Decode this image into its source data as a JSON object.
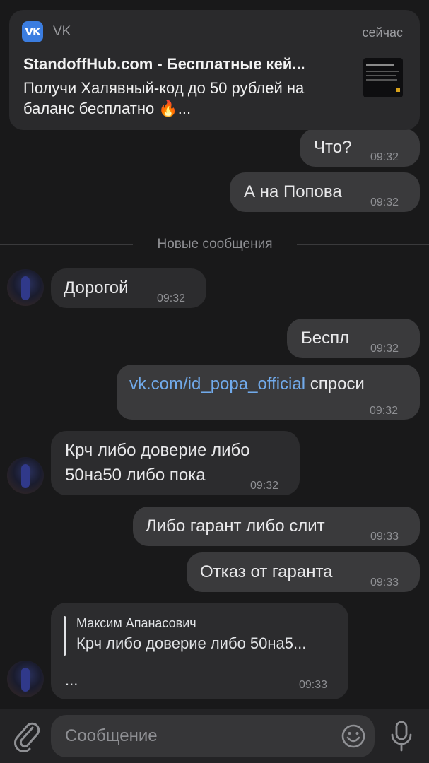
{
  "notification": {
    "app_name": "VK",
    "logo_text": "VK",
    "time": "сейчас",
    "title": "StandoffHub.com - Бесплатные кей...",
    "body": "Получи Халявный-код до 50 рублей на баланс бесплатно 🔥..."
  },
  "divider": {
    "label": "Новые сообщения"
  },
  "messages": [
    {
      "text": "Что?",
      "time": "09:32"
    },
    {
      "text": "А на Попова",
      "time": "09:32"
    },
    {
      "text": "Дорогой",
      "time": "09:32"
    },
    {
      "text": "Беспл",
      "time": "09:32"
    },
    {
      "link": "vk.com/id_popa_official",
      "text": "спроси",
      "time": "09:32"
    },
    {
      "line1": "Крч либо доверие либо",
      "line2": "50на50 либо пока",
      "time": "09:32"
    },
    {
      "text": "Либо гарант либо слит",
      "time": "09:33"
    },
    {
      "text": "Отказ от гаранта",
      "time": "09:33"
    },
    {
      "reply_name": "Максим Апанасович",
      "reply_text": "Крч либо доверие либо 50на5...",
      "text": "...",
      "time": "09:33"
    }
  ],
  "composer": {
    "placeholder": "Сообщение"
  },
  "colors": {
    "background": "#19191a",
    "bubble": "#3a3a3c",
    "link": "#71aaeb",
    "accent": "#3b7de0"
  },
  "icons": [
    "vk-logo",
    "avatar",
    "attach-icon",
    "emoji-icon",
    "mic-icon"
  ]
}
